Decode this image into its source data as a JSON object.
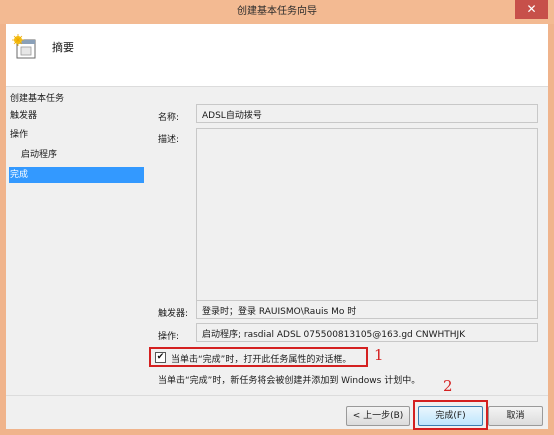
{
  "window": {
    "title": "创建基本任务向导",
    "close_glyph": "✕"
  },
  "header": {
    "title": "摘要",
    "icon": "task-calendar-icon"
  },
  "nav": {
    "items": [
      {
        "label": "创建基本任务"
      },
      {
        "label": "触发器"
      },
      {
        "label": "操作"
      },
      {
        "label": "启动程序"
      },
      {
        "label": "完成"
      }
    ]
  },
  "summary": {
    "name_label": "名称:",
    "name_value": "ADSL自动拨号",
    "desc_label": "描述:",
    "desc_value": "",
    "trigger_label": "触发器:",
    "trigger_value": "登录时；登录 RAUISMO\\Rauis Mo 时",
    "action_label": "操作:",
    "action_value": "启动程序; rasdial ADSL 075500813105@163.gd CNWHTHJK"
  },
  "open_properties": {
    "label": "当单击“完成”时，打开此任务属性的对话框。",
    "checked": true,
    "check_glyph": "✔"
  },
  "info_text": "当单击“完成”时，新任务将会被创建并添加到 Windows 计划中。",
  "annotations": {
    "marker_1": "1",
    "marker_2": "2",
    "color": "#d42020"
  },
  "buttons": {
    "back": "< 上一步(B)",
    "finish": "完成(F)",
    "cancel": "取消"
  }
}
